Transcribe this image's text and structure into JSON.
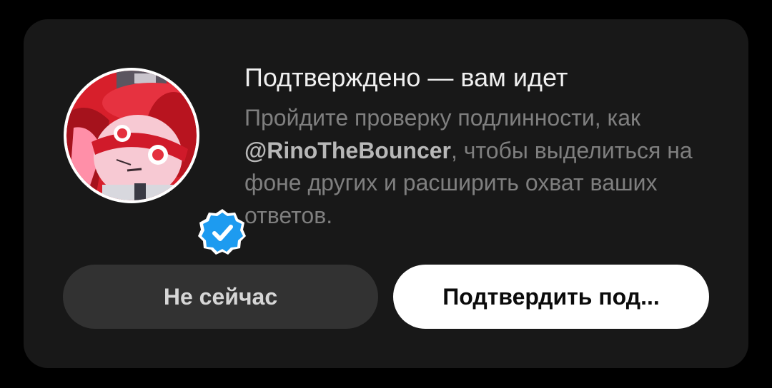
{
  "dialog": {
    "title": "Подтверждено — вам идет",
    "description_before": "Пройдите проверку подлинности, как ",
    "handle": "@RinoTheBouncer",
    "description_after": ", чтобы выделиться на фоне других и расширить охват ваших ответов.",
    "secondary_button": "Не сейчас",
    "primary_button": "Подтвердить под...",
    "icons": {
      "avatar": "profile-avatar",
      "badge": "verified-checkmark-icon"
    },
    "colors": {
      "card_background": "#181818",
      "badge_blue": "#1d9bf0",
      "title": "#efefef",
      "description": "#7f7f7f",
      "secondary_button": "#323232",
      "primary_button": "#ffffff"
    }
  }
}
